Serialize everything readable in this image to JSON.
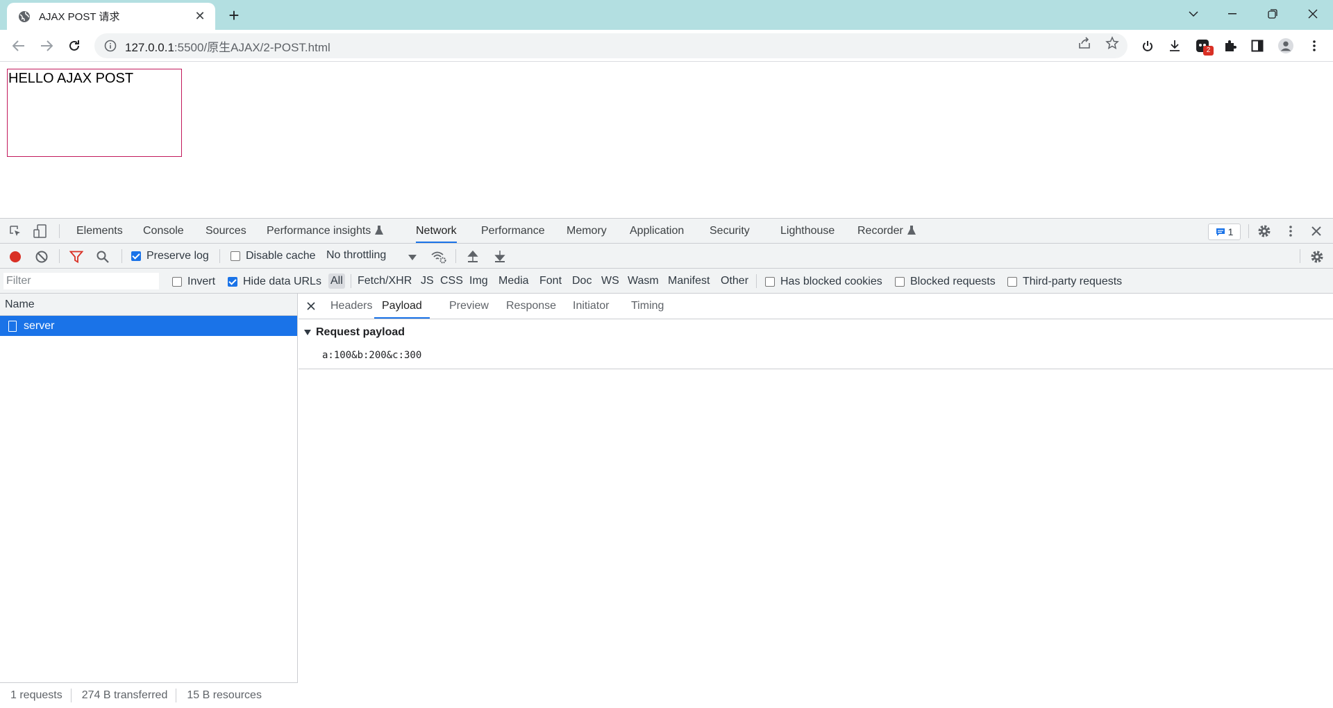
{
  "browser": {
    "tab_title": "AJAX POST 请求",
    "url_host": "127.0.0.1",
    "url_path": ":5500/原生AJAX/2-POST.html",
    "extension_badge": "2"
  },
  "page": {
    "box_text": "HELLO AJAX POST"
  },
  "devtools": {
    "tabs": [
      {
        "label": "Elements"
      },
      {
        "label": "Console"
      },
      {
        "label": "Sources"
      },
      {
        "label": "Performance insights"
      },
      {
        "label": "Network"
      },
      {
        "label": "Performance"
      },
      {
        "label": "Memory"
      },
      {
        "label": "Application"
      },
      {
        "label": "Security"
      },
      {
        "label": "Lighthouse"
      },
      {
        "label": "Recorder"
      }
    ],
    "active_tab": "Network",
    "issues_count": "1",
    "network": {
      "preserve_log": "Preserve log",
      "disable_cache": "Disable cache",
      "throttling": "No throttling",
      "filter_placeholder": "Filter",
      "invert": "Invert",
      "hide_data_urls": "Hide data URLs",
      "types": [
        "All",
        "Fetch/XHR",
        "JS",
        "CSS",
        "Img",
        "Media",
        "Font",
        "Doc",
        "WS",
        "Wasm",
        "Manifest",
        "Other"
      ],
      "has_blocked_cookies": "Has blocked cookies",
      "blocked_requests": "Blocked requests",
      "third_party": "Third-party requests",
      "column_name": "Name",
      "requests": [
        {
          "name": "server"
        }
      ],
      "status": {
        "requests": "1 requests",
        "transferred": "274 B transferred",
        "resources": "15 B resources"
      }
    },
    "detail": {
      "tabs": [
        "Headers",
        "Payload",
        "Preview",
        "Response",
        "Initiator",
        "Timing"
      ],
      "active": "Payload",
      "section_title": "Request payload",
      "payload_value": "a:100&b:200&c:300"
    }
  },
  "colors": {
    "accent": "#1a73e8",
    "titlebar": "#b3dfe1",
    "record": "#d93025",
    "box_border": "#c2185b"
  }
}
